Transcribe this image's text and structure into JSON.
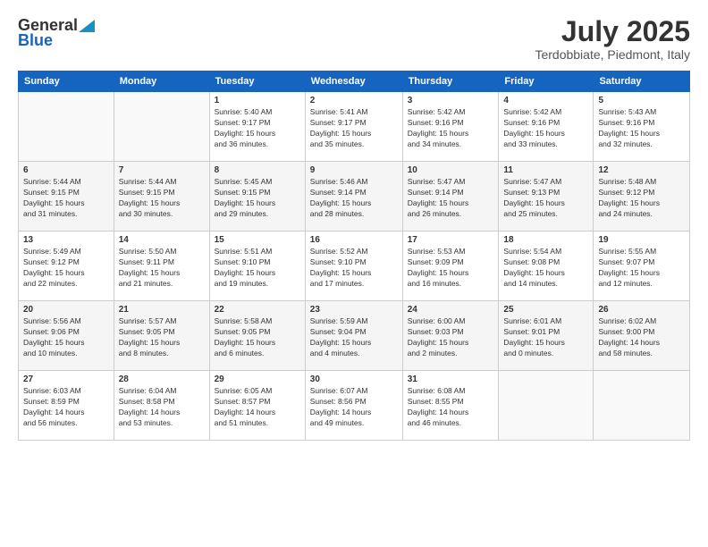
{
  "header": {
    "logo_general": "General",
    "logo_blue": "Blue",
    "month_title": "July 2025",
    "location": "Terdobbiate, Piedmont, Italy"
  },
  "calendar": {
    "days_of_week": [
      "Sunday",
      "Monday",
      "Tuesday",
      "Wednesday",
      "Thursday",
      "Friday",
      "Saturday"
    ],
    "weeks": [
      [
        {
          "day": "",
          "detail": ""
        },
        {
          "day": "",
          "detail": ""
        },
        {
          "day": "1",
          "detail": "Sunrise: 5:40 AM\nSunset: 9:17 PM\nDaylight: 15 hours\nand 36 minutes."
        },
        {
          "day": "2",
          "detail": "Sunrise: 5:41 AM\nSunset: 9:17 PM\nDaylight: 15 hours\nand 35 minutes."
        },
        {
          "day": "3",
          "detail": "Sunrise: 5:42 AM\nSunset: 9:16 PM\nDaylight: 15 hours\nand 34 minutes."
        },
        {
          "day": "4",
          "detail": "Sunrise: 5:42 AM\nSunset: 9:16 PM\nDaylight: 15 hours\nand 33 minutes."
        },
        {
          "day": "5",
          "detail": "Sunrise: 5:43 AM\nSunset: 9:16 PM\nDaylight: 15 hours\nand 32 minutes."
        }
      ],
      [
        {
          "day": "6",
          "detail": "Sunrise: 5:44 AM\nSunset: 9:15 PM\nDaylight: 15 hours\nand 31 minutes."
        },
        {
          "day": "7",
          "detail": "Sunrise: 5:44 AM\nSunset: 9:15 PM\nDaylight: 15 hours\nand 30 minutes."
        },
        {
          "day": "8",
          "detail": "Sunrise: 5:45 AM\nSunset: 9:15 PM\nDaylight: 15 hours\nand 29 minutes."
        },
        {
          "day": "9",
          "detail": "Sunrise: 5:46 AM\nSunset: 9:14 PM\nDaylight: 15 hours\nand 28 minutes."
        },
        {
          "day": "10",
          "detail": "Sunrise: 5:47 AM\nSunset: 9:14 PM\nDaylight: 15 hours\nand 26 minutes."
        },
        {
          "day": "11",
          "detail": "Sunrise: 5:47 AM\nSunset: 9:13 PM\nDaylight: 15 hours\nand 25 minutes."
        },
        {
          "day": "12",
          "detail": "Sunrise: 5:48 AM\nSunset: 9:12 PM\nDaylight: 15 hours\nand 24 minutes."
        }
      ],
      [
        {
          "day": "13",
          "detail": "Sunrise: 5:49 AM\nSunset: 9:12 PM\nDaylight: 15 hours\nand 22 minutes."
        },
        {
          "day": "14",
          "detail": "Sunrise: 5:50 AM\nSunset: 9:11 PM\nDaylight: 15 hours\nand 21 minutes."
        },
        {
          "day": "15",
          "detail": "Sunrise: 5:51 AM\nSunset: 9:10 PM\nDaylight: 15 hours\nand 19 minutes."
        },
        {
          "day": "16",
          "detail": "Sunrise: 5:52 AM\nSunset: 9:10 PM\nDaylight: 15 hours\nand 17 minutes."
        },
        {
          "day": "17",
          "detail": "Sunrise: 5:53 AM\nSunset: 9:09 PM\nDaylight: 15 hours\nand 16 minutes."
        },
        {
          "day": "18",
          "detail": "Sunrise: 5:54 AM\nSunset: 9:08 PM\nDaylight: 15 hours\nand 14 minutes."
        },
        {
          "day": "19",
          "detail": "Sunrise: 5:55 AM\nSunset: 9:07 PM\nDaylight: 15 hours\nand 12 minutes."
        }
      ],
      [
        {
          "day": "20",
          "detail": "Sunrise: 5:56 AM\nSunset: 9:06 PM\nDaylight: 15 hours\nand 10 minutes."
        },
        {
          "day": "21",
          "detail": "Sunrise: 5:57 AM\nSunset: 9:05 PM\nDaylight: 15 hours\nand 8 minutes."
        },
        {
          "day": "22",
          "detail": "Sunrise: 5:58 AM\nSunset: 9:05 PM\nDaylight: 15 hours\nand 6 minutes."
        },
        {
          "day": "23",
          "detail": "Sunrise: 5:59 AM\nSunset: 9:04 PM\nDaylight: 15 hours\nand 4 minutes."
        },
        {
          "day": "24",
          "detail": "Sunrise: 6:00 AM\nSunset: 9:03 PM\nDaylight: 15 hours\nand 2 minutes."
        },
        {
          "day": "25",
          "detail": "Sunrise: 6:01 AM\nSunset: 9:01 PM\nDaylight: 15 hours\nand 0 minutes."
        },
        {
          "day": "26",
          "detail": "Sunrise: 6:02 AM\nSunset: 9:00 PM\nDaylight: 14 hours\nand 58 minutes."
        }
      ],
      [
        {
          "day": "27",
          "detail": "Sunrise: 6:03 AM\nSunset: 8:59 PM\nDaylight: 14 hours\nand 56 minutes."
        },
        {
          "day": "28",
          "detail": "Sunrise: 6:04 AM\nSunset: 8:58 PM\nDaylight: 14 hours\nand 53 minutes."
        },
        {
          "day": "29",
          "detail": "Sunrise: 6:05 AM\nSunset: 8:57 PM\nDaylight: 14 hours\nand 51 minutes."
        },
        {
          "day": "30",
          "detail": "Sunrise: 6:07 AM\nSunset: 8:56 PM\nDaylight: 14 hours\nand 49 minutes."
        },
        {
          "day": "31",
          "detail": "Sunrise: 6:08 AM\nSunset: 8:55 PM\nDaylight: 14 hours\nand 46 minutes."
        },
        {
          "day": "",
          "detail": ""
        },
        {
          "day": "",
          "detail": ""
        }
      ]
    ]
  }
}
